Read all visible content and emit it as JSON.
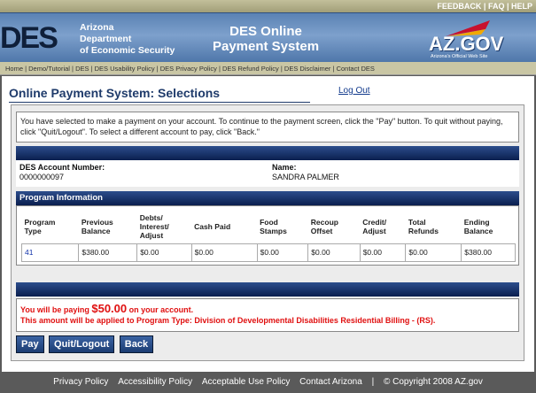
{
  "top_links": [
    "FEEDBACK",
    "FAQ",
    "HELP"
  ],
  "header": {
    "logo": "DES",
    "dept": [
      "Arizona",
      "Department",
      "of Economic Security"
    ],
    "app_title": [
      "DES Online",
      "Payment System"
    ],
    "azgov": "AZ.GOV",
    "azgov_tag": "Arizona's Official Web Site"
  },
  "nav": [
    "Home",
    "Demo/Tutorial",
    "DES",
    "DES Usability Policy",
    "DES Privacy Policy",
    "DES Refund Policy",
    "DES Disclaimer",
    "Contact DES"
  ],
  "page": {
    "title": "Online Payment System: Selections",
    "logout": "Log Out",
    "instructions": "You have selected to make a payment on your account. To continue to the payment screen, click the \"Pay\" button. To quit without paying, click \"Quit/Logout\". To select a different account to pay, click \"Back.\"",
    "account_label": "DES Account Number:",
    "account_number": "0000000097",
    "name_label": "Name:",
    "name": "SANDRA PALMER",
    "program_header": "Program Information",
    "columns": [
      [
        "Program",
        "Type"
      ],
      [
        "Previous",
        "Balance"
      ],
      [
        "Debts/",
        "Interest/",
        "Adjust"
      ],
      [
        "Cash Paid"
      ],
      [
        "Food",
        "Stamps"
      ],
      [
        "Recoup",
        "Offset"
      ],
      [
        "Credit/",
        "Adjust"
      ],
      [
        "Total",
        "Refunds"
      ],
      [
        "Ending",
        "Balance"
      ]
    ],
    "row": [
      "41",
      "$380.00",
      "$0.00",
      "$0.00",
      "$0.00",
      "$0.00",
      "$0.00",
      "$0.00",
      "$380.00"
    ],
    "msg_pre": "You will be paying",
    "msg_amount": "$50.00",
    "msg_post": "on your account.",
    "msg_line2": "This amount will be applied to Program Type: Division of Developmental Disabilities Residential Billing - (RS).",
    "buttons": {
      "pay": "Pay",
      "quit": "Quit/Logout",
      "back": "Back"
    }
  },
  "footer": [
    "Privacy Policy",
    "Accessibility Policy",
    "Acceptable Use Policy",
    "Contact Arizona",
    "|",
    "© Copyright 2008 AZ.gov"
  ]
}
